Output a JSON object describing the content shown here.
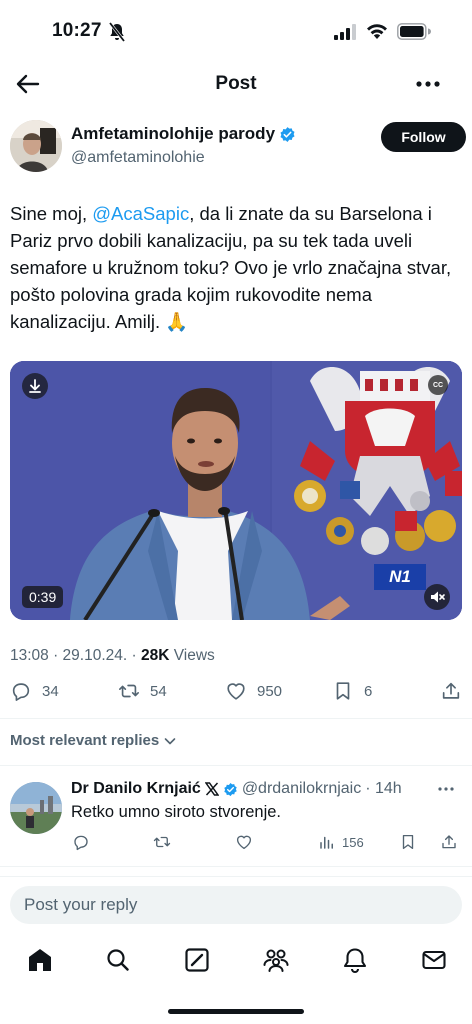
{
  "status_bar": {
    "time": "10:27"
  },
  "topnav": {
    "title": "Post"
  },
  "author": {
    "name": "Amfetaminolohije parody",
    "handle": "@amfetaminolohie",
    "follow_label": "Follow"
  },
  "tweet": {
    "text_before": "Sine moj, ",
    "mention": "@AcaSapic",
    "text_after": ", da li znate da su Barselona i Pariz prvo dobili  kanalizaciju, pa su tek tada uveli semafore u kružnom toku? Ovo je vrlo značajna stvar, pošto polovina grada kojim rukovodite nema kanalizaciju. Amilj. 🙏",
    "media": {
      "duration": "0:39",
      "cc": "CC",
      "channel_logo": "N1"
    },
    "time": "13:08 · 29.10.24. · ",
    "views_count": "28K",
    "views_label": " Views"
  },
  "actions": {
    "replies": "34",
    "reposts": "54",
    "likes": "950",
    "bookmarks": "6"
  },
  "replies_sort": {
    "label": "Most relevant replies"
  },
  "reply": {
    "name": "Dr Danilo Krnjaić",
    "handle": "@drdanilokrnjaic",
    "time": "· 14h",
    "text": "Retko umno siroto stvorenje.",
    "views": "156"
  },
  "reply_box": {
    "placeholder": "Post your reply"
  },
  "colors": {
    "accent": "#1d9bf0",
    "text": "#0f1419",
    "muted": "#536471",
    "media_bg": "#4a53a4"
  },
  "icons": [
    "bell-slash-icon",
    "signal-icon",
    "wifi-icon",
    "battery-icon",
    "back-arrow-icon",
    "more-icon",
    "verified-badge-icon",
    "download-icon",
    "mute-icon",
    "reply-icon",
    "repost-icon",
    "like-icon",
    "bookmark-icon",
    "share-icon",
    "chevron-down-icon",
    "x-logo-icon",
    "views-icon",
    "home-icon",
    "search-icon",
    "grok-icon",
    "communities-icon",
    "notifications-icon",
    "messages-icon"
  ]
}
